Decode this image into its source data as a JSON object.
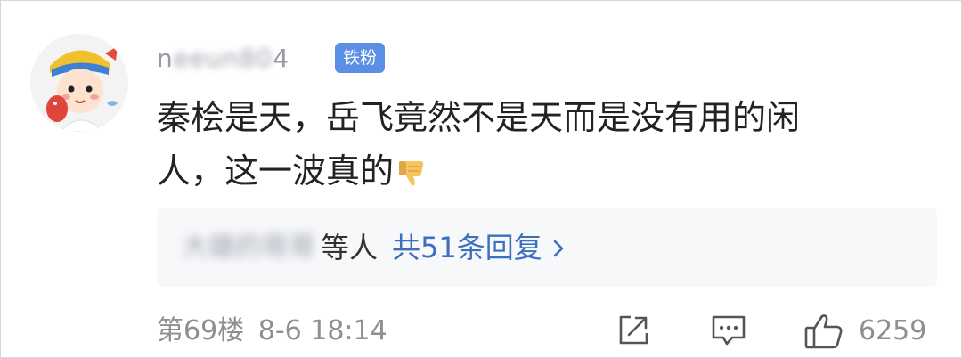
{
  "comment": {
    "username": "n",
    "username_blurred": "eeun80",
    "username_end": "4",
    "badge": "铁粉",
    "text_line1": "秦桧是天，岳飞竟然不是天而是没有用的闲",
    "text_line2": "人，这一波真的",
    "emoji": "thumbs-down-icon"
  },
  "replies": {
    "names_blurred": "大雄的哥哥",
    "suffix": "等人",
    "count_label": "共51条回复"
  },
  "footer": {
    "floor": "第69楼",
    "datetime": "8-6 18:14",
    "like_count": "6259"
  },
  "colors": {
    "badge_bg": "#5b8fe6",
    "link": "#3e6fbf",
    "meta_text": "#8e8e93",
    "body_text": "#222222",
    "reply_box_bg": "#f7f8fa"
  }
}
